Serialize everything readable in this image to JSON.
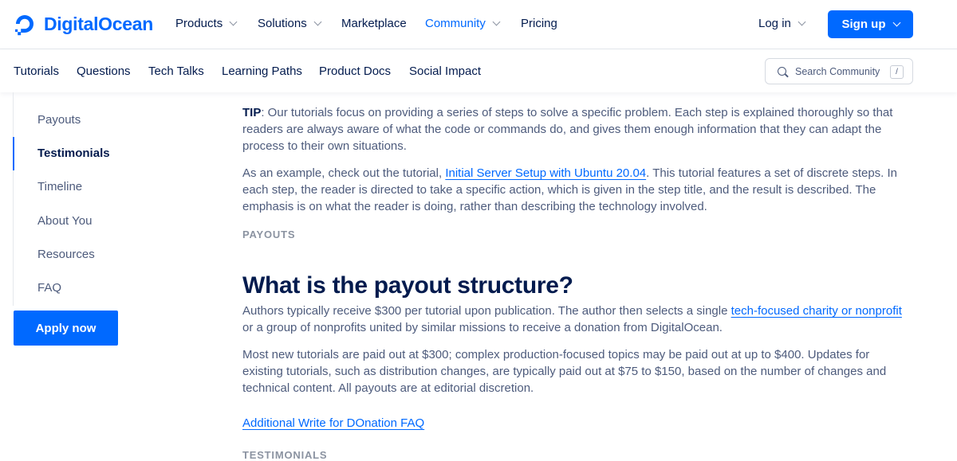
{
  "brand": {
    "name": "DigitalOcean",
    "color": "#0069ff"
  },
  "top_nav": {
    "items": [
      {
        "label": "Products",
        "has_menu": true
      },
      {
        "label": "Solutions",
        "has_menu": true
      },
      {
        "label": "Marketplace",
        "has_menu": false
      },
      {
        "label": "Community",
        "has_menu": true,
        "active": true
      },
      {
        "label": "Pricing",
        "has_menu": false
      }
    ],
    "login_label": "Log in",
    "signup_label": "Sign up"
  },
  "sub_nav": {
    "items": [
      "Tutorials",
      "Questions",
      "Tech Talks",
      "Learning Paths",
      "Product Docs",
      "Social Impact"
    ],
    "search": {
      "placeholder": "Search Community",
      "shortcut": "/"
    }
  },
  "sidebar": {
    "items": [
      {
        "label": "Payouts",
        "active": false
      },
      {
        "label": "Testimonials",
        "active": true
      },
      {
        "label": "Timeline",
        "active": false
      },
      {
        "label": "About You",
        "active": false
      },
      {
        "label": "Resources",
        "active": false
      },
      {
        "label": "FAQ",
        "active": false
      }
    ],
    "apply_label": "Apply now"
  },
  "content": {
    "tip": {
      "label": "TIP",
      "text": ": Our tutorials focus on providing a series of steps to solve a specific problem. Each step is explained thoroughly so that readers are always aware of what the code or commands do, and gives them enough information that they can adapt the process to their own situations."
    },
    "example": {
      "before": "As an example, check out the tutorial, ",
      "link": "Initial Server Setup with Ubuntu 20.04",
      "after": ". This tutorial features a set of discrete steps. In each step, the reader is directed to take a specific action, which is given in the step title, and the result is described. The emphasis is on what the reader is doing, rather than describing the technology involved."
    },
    "payouts_eyebrow": "PAYOUTS",
    "payout_heading": "What is the payout structure?",
    "payout_p1": {
      "before": "Authors typically receive $300 per tutorial upon publication. The author then selects a single ",
      "link": "tech-focused charity or nonprofit",
      "after": " or a group of nonprofits united by similar missions to receive a donation from DigitalOcean."
    },
    "payout_p2": "Most new tutorials are paid out at $300; complex production-focused topics may be paid out at up to $400. Updates for existing tutorials, such as distribution changes, are typically paid out at $75 to $150, based on the number of changes and technical content. All payouts are at editorial discretion.",
    "faq_link": "Additional Write for DOnation FAQ",
    "testimonials_eyebrow": "TESTIMONIALS"
  }
}
